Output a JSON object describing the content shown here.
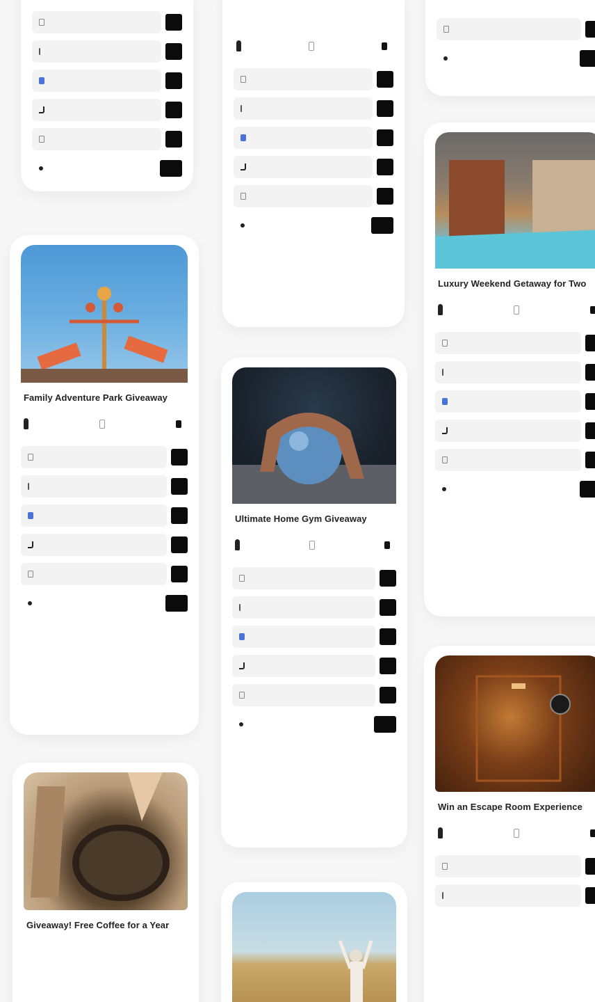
{
  "colors": {
    "page_bg": "#f7f7f8",
    "card_bg": "#ffffff",
    "row_bg": "#f3f3f4",
    "button_bg": "#0b0b0b",
    "facebook": "#4a72d8"
  },
  "stat_icons": [
    "person-icon",
    "calendar-icon",
    "clock-icon"
  ],
  "cards": [
    {
      "id": "family-adventure",
      "title": "Family Adventure Park Giveaway",
      "description": "",
      "image": "amusement-park-ride",
      "stats": [
        {
          "label": "",
          "value": ""
        },
        {
          "label": "",
          "value": ""
        },
        {
          "label": "",
          "value": ""
        }
      ],
      "ways_title": "",
      "entries": [
        {
          "icon": "grid-icon",
          "label": "",
          "button": ""
        },
        {
          "icon": "dollar-icon",
          "label": "",
          "button": ""
        },
        {
          "icon": "facebook-icon",
          "label": "",
          "button": ""
        },
        {
          "icon": "tiktok-icon",
          "label": "",
          "button": ""
        },
        {
          "icon": "mail-icon",
          "label": "",
          "button": ""
        },
        {
          "icon": "refer-icon",
          "label": "",
          "button": ""
        }
      ]
    },
    {
      "id": "free-coffee",
      "title": "Giveaway! Free Coffee for a Year",
      "description": "",
      "image": "coffee-beans"
    },
    {
      "id": "home-gym",
      "title": "Ultimate Home Gym Giveaway",
      "description": "",
      "image": "exercise-ball",
      "stats": [
        {
          "label": "",
          "value": ""
        },
        {
          "label": "",
          "value": ""
        },
        {
          "label": "",
          "value": ""
        }
      ],
      "ways_title": "",
      "entries": [
        {
          "icon": "grid-icon",
          "label": "",
          "button": ""
        },
        {
          "icon": "dollar-icon",
          "label": "",
          "button": ""
        },
        {
          "icon": "facebook-icon",
          "label": "",
          "button": ""
        },
        {
          "icon": "tiktok-icon",
          "label": "",
          "button": ""
        },
        {
          "icon": "mail-icon",
          "label": "",
          "button": ""
        },
        {
          "icon": "refer-icon",
          "label": "",
          "button": ""
        }
      ]
    },
    {
      "id": "luxury-weekend",
      "title": "Luxury Weekend Getaway for Two",
      "description": "",
      "image": "hotel-pool",
      "stats": [
        {
          "label": "",
          "value": ""
        },
        {
          "label": "",
          "value": ""
        },
        {
          "label": "",
          "value": ""
        }
      ],
      "ways_title": "",
      "entries": [
        {
          "icon": "grid-icon",
          "label": "",
          "button": ""
        },
        {
          "icon": "dollar-icon",
          "label": "",
          "button": ""
        },
        {
          "icon": "facebook-icon",
          "label": "",
          "button": ""
        },
        {
          "icon": "tiktok-icon",
          "label": "",
          "button": ""
        },
        {
          "icon": "mail-icon",
          "label": "",
          "button": ""
        },
        {
          "icon": "refer-icon",
          "label": "",
          "button": ""
        }
      ]
    },
    {
      "id": "escape-room",
      "title": "Win an Escape Room Experience",
      "description": "",
      "image": "escape-room-door",
      "stats": [
        {
          "label": "",
          "value": ""
        },
        {
          "label": "",
          "value": ""
        },
        {
          "label": "",
          "value": ""
        }
      ],
      "ways_title": "",
      "entries": [
        {
          "icon": "grid-icon",
          "label": "",
          "button": ""
        },
        {
          "icon": "dollar-icon",
          "label": "",
          "button": ""
        }
      ]
    },
    {
      "id": "top-left-partial",
      "entries": [
        {
          "icon": "grid-icon",
          "label": "",
          "button": ""
        },
        {
          "icon": "dollar-icon",
          "label": "",
          "button": ""
        },
        {
          "icon": "facebook-icon",
          "label": "",
          "button": ""
        },
        {
          "icon": "tiktok-icon",
          "label": "",
          "button": ""
        },
        {
          "icon": "mail-icon",
          "label": "",
          "button": ""
        },
        {
          "icon": "refer-icon",
          "label": "",
          "button": ""
        }
      ]
    },
    {
      "id": "top-middle-partial",
      "description": "",
      "stats": [
        {
          "label": "",
          "value": ""
        },
        {
          "label": "",
          "value": ""
        },
        {
          "label": "",
          "value": ""
        }
      ],
      "ways_title": "",
      "entries": [
        {
          "icon": "grid-icon",
          "label": "",
          "button": ""
        },
        {
          "icon": "dollar-icon",
          "label": "",
          "button": ""
        },
        {
          "icon": "facebook-icon",
          "label": "",
          "button": ""
        },
        {
          "icon": "tiktok-icon",
          "label": "",
          "button": ""
        },
        {
          "icon": "mail-icon",
          "label": "",
          "button": ""
        },
        {
          "icon": "refer-icon",
          "label": "",
          "button": ""
        }
      ]
    },
    {
      "id": "top-right-partial",
      "entries": [
        {
          "icon": "mail-icon",
          "label": "",
          "button": ""
        },
        {
          "icon": "refer-icon",
          "label": "",
          "button": ""
        }
      ]
    },
    {
      "id": "bottom-middle-partial",
      "image": "wheat-field-person"
    }
  ]
}
